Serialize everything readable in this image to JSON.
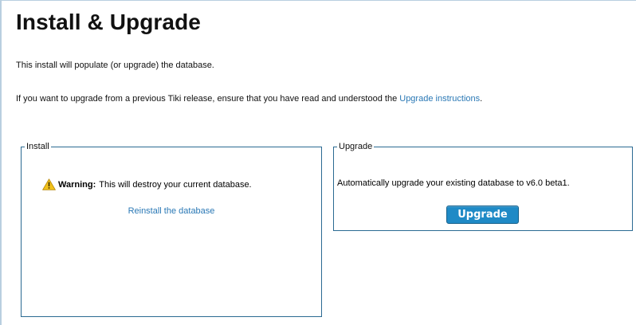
{
  "page": {
    "title": "Install & Upgrade",
    "intro_line_1": "This install will populate (or upgrade) the database.",
    "intro_line_2_prefix": "If you want to upgrade from a previous Tiki release, ensure that you have read and understood the ",
    "intro_line_2_link": "Upgrade instructions",
    "intro_line_2_suffix": "."
  },
  "install": {
    "legend": "Install",
    "warning_label": "Warning:",
    "warning_text": "This will destroy your current database.",
    "reinstall_link": "Reinstall the database"
  },
  "upgrade": {
    "legend": "Upgrade",
    "description": "Automatically upgrade your existing database to v6.0 beta1.",
    "button_label": "Upgrade"
  },
  "icons": {
    "warning": "warning-icon"
  },
  "colors": {
    "link": "#2a78b5",
    "panel_border": "#2b6a92",
    "button_bg": "#1f8ac6",
    "warning_fill": "#f2c21b"
  }
}
